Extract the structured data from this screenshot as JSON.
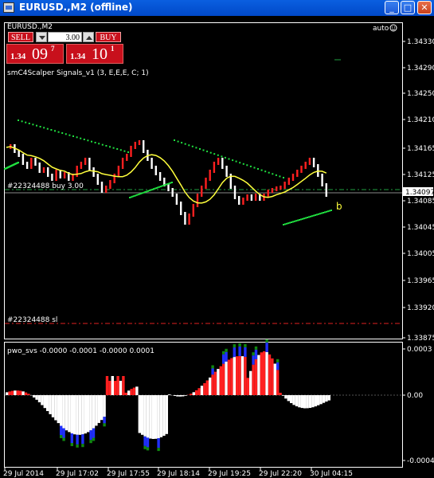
{
  "window": {
    "title": "EURUSD.,M2 (offline)",
    "buttons": {
      "minimize": "_",
      "maximize": "□",
      "close": "✕"
    }
  },
  "chart": {
    "symbol_label": "EURUSD.,M2",
    "auto_label": "auto",
    "indicator_main": "smC4Scalper Signals_v1 (3, E,E,E, C; 1)",
    "buy_line_label": "#22324488 buy 3.00",
    "sl_line_label": "#22324488 sl",
    "signal_letter": "b",
    "current_price_tag": "1.34097",
    "price_axis": [
      "1.34330",
      "1.34290",
      "1.34250",
      "1.34210",
      "1.34165",
      "1.34125",
      "1.34085",
      "1.34045",
      "1.34005",
      "1.33965",
      "1.33920",
      "1.33875"
    ],
    "sub_indicator": "pwo_svs -0.0000 -0.0001 -0.0000 0.0001",
    "sub_axis": [
      "0.0003",
      "0.00",
      "-0.0004"
    ],
    "time_axis": [
      "29 Jul 2014",
      "29 Jul 17:02",
      "29 Jul 17:55",
      "29 Jul 18:14",
      "29 Jul 19:25",
      "29 Jul 22:20",
      "30 Jul 04:15"
    ],
    "colors": {
      "up": "#ff2020",
      "down": "#ffffff",
      "ma": "#ffff3c",
      "signal": "#20e040",
      "hist_blue": "#2030ff",
      "hist_green": "#108810"
    }
  },
  "trade_panel": {
    "sell_label": "SELL",
    "buy_label": "BUY",
    "lot_value": "3.00",
    "bid_prefix": "1.34",
    "bid_big": "09",
    "bid_sup": "7",
    "ask_prefix": "1.34",
    "ask_big": "10",
    "ask_sup": "1"
  }
}
